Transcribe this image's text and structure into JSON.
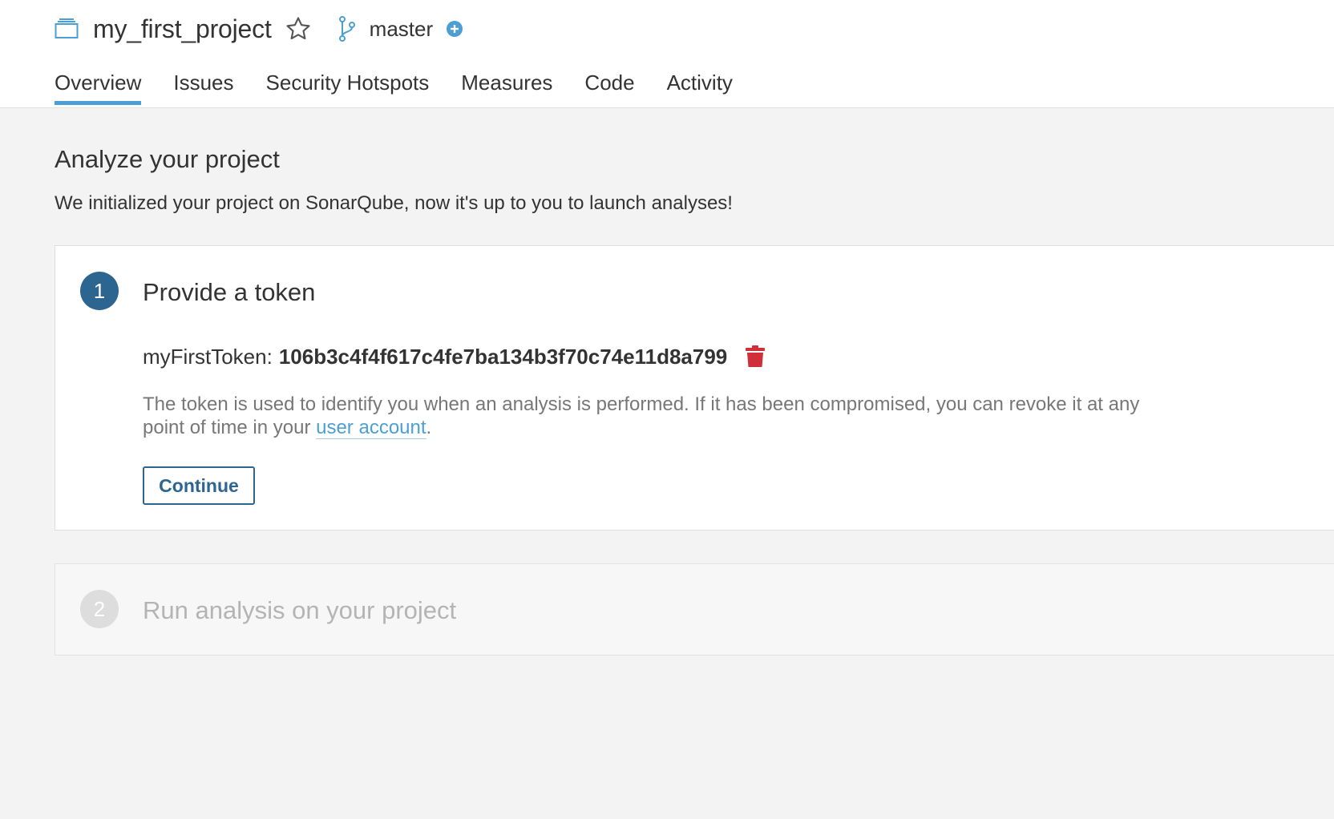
{
  "header": {
    "project_name": "my_first_project",
    "branch_name": "master",
    "icons": {
      "project": "project-icon",
      "favorite": "star-icon",
      "branch": "branch-icon",
      "add_branch": "plus-circle-icon"
    },
    "tabs": [
      {
        "label": "Overview",
        "active": true
      },
      {
        "label": "Issues",
        "active": false
      },
      {
        "label": "Security Hotspots",
        "active": false
      },
      {
        "label": "Measures",
        "active": false
      },
      {
        "label": "Code",
        "active": false
      },
      {
        "label": "Activity",
        "active": false
      }
    ]
  },
  "main": {
    "title": "Analyze your project",
    "description": "We initialized your project on SonarQube, now it's up to you to launch analyses!",
    "steps": [
      {
        "number": "1",
        "title": "Provide a token",
        "token_name": "myFirstToken:",
        "token_value": "106b3c4f4f617c4fe7ba134b3f70c74e11d8a799",
        "note_before": "The token is used to identify you when an analysis is performed. If it has been compromised, you can revoke it at any point of time in your ",
        "note_link": "user account",
        "note_after": ".",
        "continue_label": "Continue",
        "delete_icon": "trash-icon"
      },
      {
        "number": "2",
        "title": "Run analysis on your project"
      }
    ]
  },
  "colors": {
    "accent": "#4b9fd5",
    "primary": "#2d6591",
    "danger": "#d02f3a",
    "background": "#f3f3f3"
  }
}
